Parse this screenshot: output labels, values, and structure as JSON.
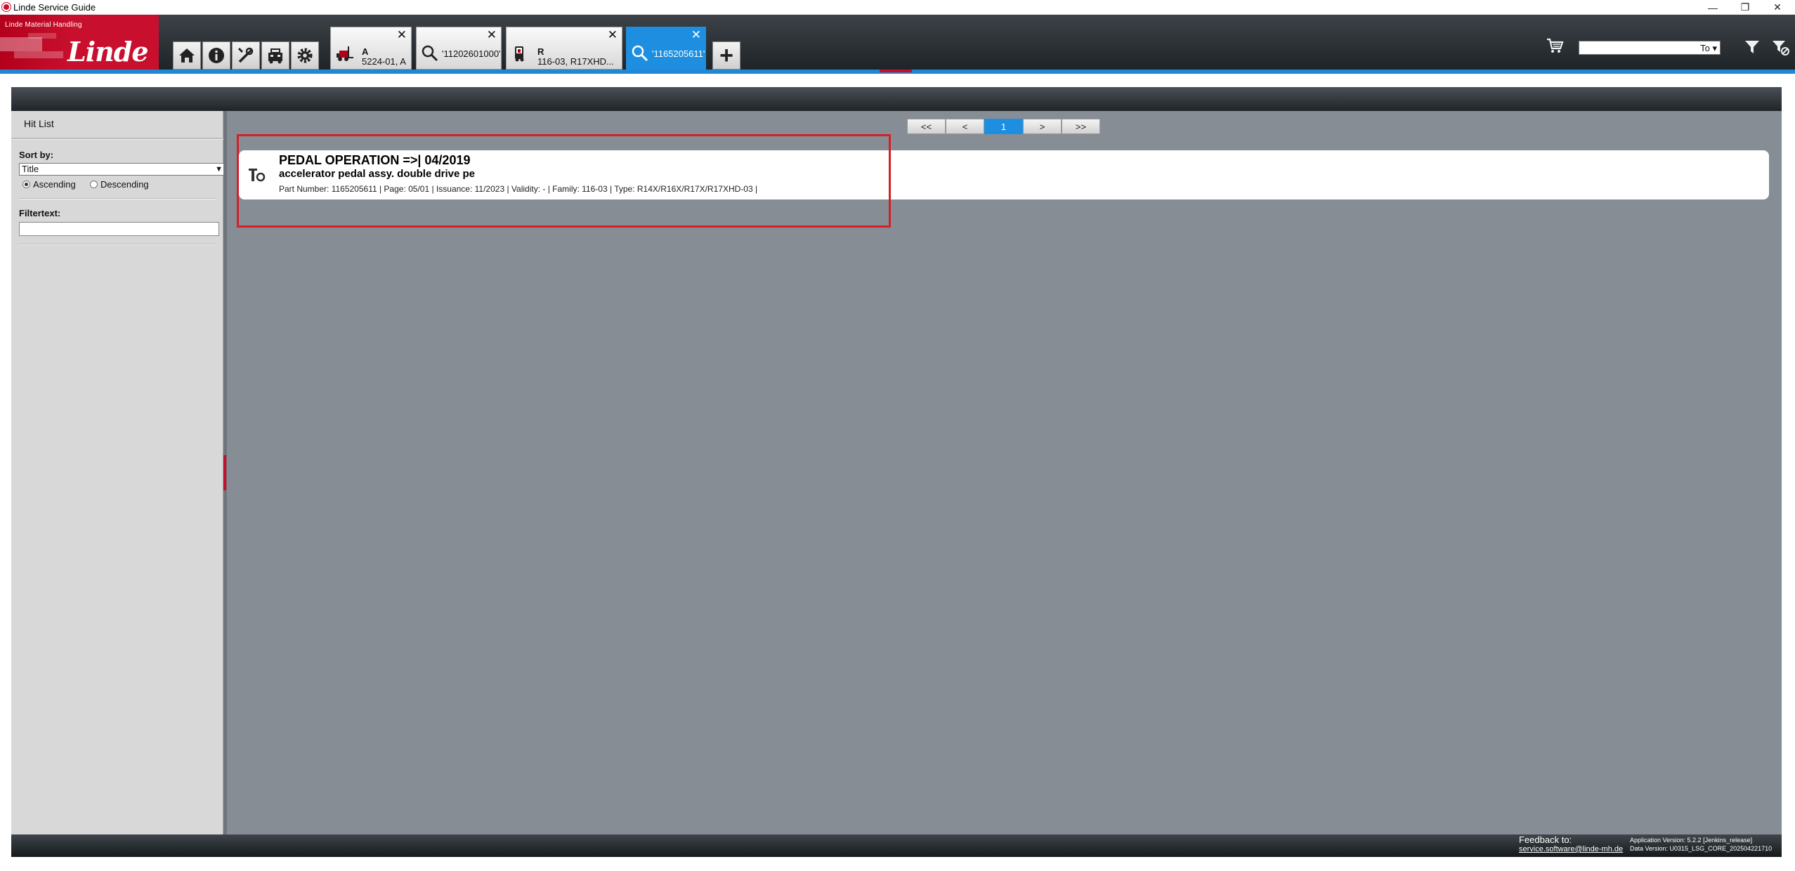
{
  "window": {
    "title": "Linde Service Guide",
    "minimize_glyph": "—",
    "maximize_glyph": "❐",
    "close_glyph": "✕"
  },
  "logo": {
    "tagline": "Linde Material Handling",
    "brand": "Linde"
  },
  "toolbar": {
    "icons": [
      "home-icon",
      "info-icon",
      "tools-icon",
      "diagnostics-icon",
      "settings-icon"
    ],
    "add_tab_glyph": "+"
  },
  "tabs": [
    {
      "icon": "forklift-icon",
      "line1": "A",
      "line2": "5224-01, A",
      "close": "✕",
      "active": false
    },
    {
      "icon": "search-icon",
      "label": "'11202601000'",
      "close": "✕",
      "active": false
    },
    {
      "icon": "truck-icon",
      "line1": "R",
      "line2": "116-03, R17XHD...",
      "close": "✕",
      "active": false
    },
    {
      "icon": "search-icon",
      "label": "'1165205611'",
      "close": "✕",
      "active": true
    }
  ],
  "header_right": {
    "cart_icon": "cart-icon",
    "search_value": "",
    "search_type": "To ▾",
    "filter_icon": "filter-icon",
    "filter_clear_icon": "filter-clear-icon"
  },
  "sidebar": {
    "title": "Hit List",
    "sort_label": "Sort by:",
    "sort_selected": "Title",
    "sort_arrow": "▼",
    "ascending_label": "Ascending",
    "descending_label": "Descending",
    "sort_order": "ascending",
    "filter_label": "Filtertext:",
    "filter_value": ""
  },
  "pager": {
    "first": "<<",
    "prev": "<",
    "current": "1",
    "next": ">",
    "last": ">>"
  },
  "result": {
    "icon": "to-document-icon",
    "title": "PEDAL OPERATION =>| 04/2019",
    "subtitle": "accelerator pedal assy.  double drive pe",
    "meta": "Part Number: 1165205611 |  Page: 05/01 |  Issuance: 11/2023 |  Validity:  - |  Family: 116-03 |  Type: R14X/R16X/R17X/R17XHD-03 |"
  },
  "footer": {
    "feedback_label": "Feedback to:",
    "feedback_email": "service.software@linde-mh.de",
    "app_version": "Application Version: 5.2.2 [Jenkins_release]",
    "data_version": "Data Version: U0315_LSG_CORE_202504221710"
  },
  "colors": {
    "brand_red": "#c8102e",
    "accent_blue": "#1e8fe0",
    "highlight_red": "#d42027",
    "content_gray": "#868d95"
  }
}
